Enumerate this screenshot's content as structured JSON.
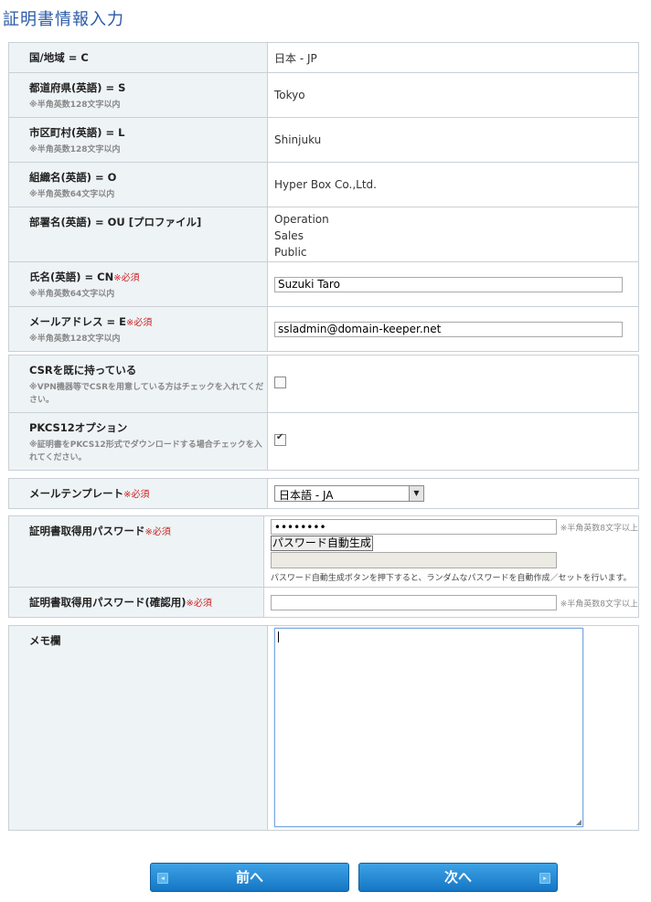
{
  "page_title": "証明書情報入力",
  "section1": {
    "country_label": "国/地域 = C",
    "country_value": "日本 - JP",
    "state_label": "都道府県(英語) = S",
    "state_note": "※半角英数128文字以内",
    "state_value": "Tokyo",
    "city_label": "市区町村(英語) = L",
    "city_note": "※半角英数128文字以内",
    "city_value": "Shinjuku",
    "org_label": "組織名(英語) = O",
    "org_note": "※半角英数64文字以内",
    "org_value": "Hyper Box Co.,Ltd.",
    "ou_label": "部署名(英語) = OU [プロファイル]",
    "ou_values": [
      "Operation",
      "Sales",
      "Public"
    ],
    "name_label": "氏名(英語) = CN",
    "name_required": "※必須",
    "name_note": "※半角英数64文字以内",
    "name_value": "Suzuki Taro",
    "email_label": "メールアドレス = E",
    "email_required": "※必須",
    "email_note": "※半角英数128文字以内",
    "email_value": "ssladmin@domain-keeper.net"
  },
  "section2": {
    "csr_label": "CSRを既に持っている",
    "csr_note": "※VPN機器等でCSRを用意している方はチェックを入れてください。",
    "csr_checked": false,
    "pkcs_label": "PKCS12オプション",
    "pkcs_note": "※証明書をPKCS12形式でダウンロードする場合チェックを入れてください。",
    "pkcs_checked": true
  },
  "section3": {
    "template_label": "メールテンプレート",
    "template_required": "※必須",
    "template_value": "日本語 - JA"
  },
  "section4": {
    "password_label": "証明書取得用パスワード",
    "password_required": "※必須",
    "password_value": "••••••••",
    "password_hint": "※半角英数8文字以上",
    "generate_button": "パスワード自動生成",
    "generate_note": "パスワード自動生成ボタンを押下すると、ランダムなパスワードを自動作成／セットを行います。",
    "confirm_label": "証明書取得用パスワード(確認用)",
    "confirm_required": "※必須",
    "confirm_hint": "※半角英数8文字以上"
  },
  "section5": {
    "memo_label": "メモ欄"
  },
  "nav": {
    "prev": "前へ",
    "next": "次へ",
    "prev_icon": "◂",
    "next_icon": "▸"
  }
}
